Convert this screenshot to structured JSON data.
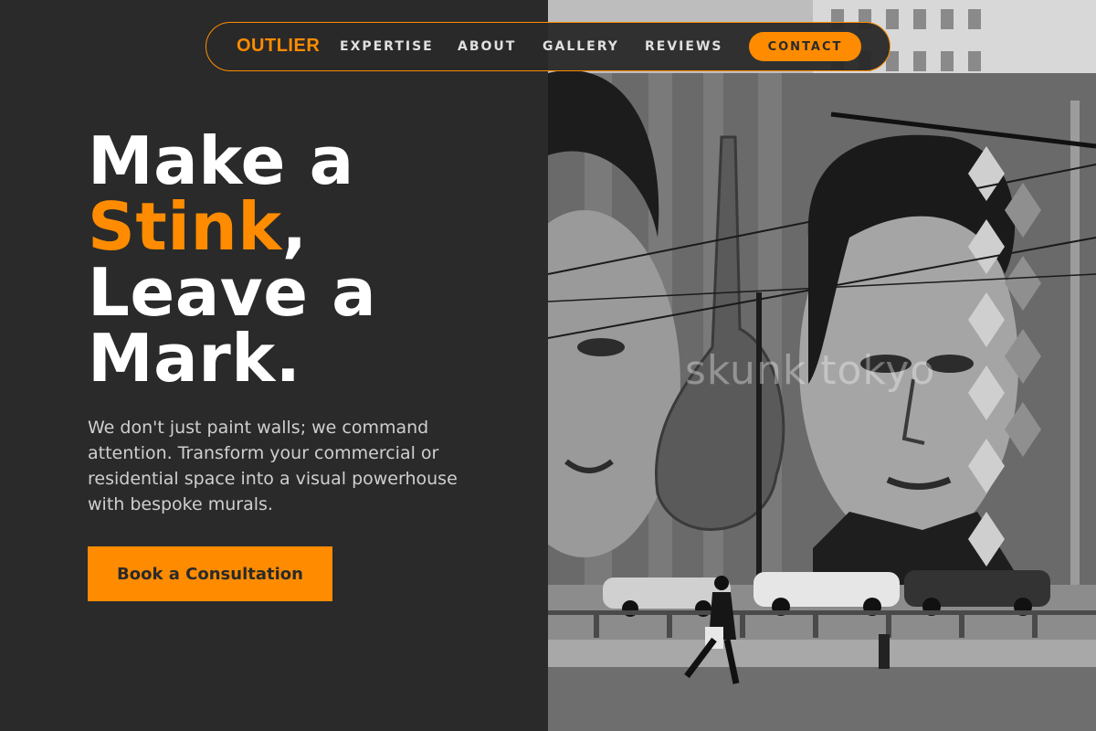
{
  "nav": {
    "logo": "OUTLIER",
    "links": [
      "EXPERTISE",
      "ABOUT",
      "GALLERY",
      "REVIEWS"
    ],
    "contact_label": "CONTACT"
  },
  "hero": {
    "headline_line1": "Make a",
    "headline_accent": "Stink",
    "headline_comma": ",",
    "headline_line3": "Leave a",
    "headline_line4": "Mark.",
    "lede": "We don't just paint walls; we command attention. Transform your commercial or residential space into a visual powerhouse with bespoke murals.",
    "cta_label": "Book a Consultation",
    "photo_watermark": "skunk tokyo"
  },
  "colors": {
    "accent": "#ff8c00",
    "background": "#2a2a2a",
    "text": "#ffffff",
    "muted_text": "#cfcfcf"
  }
}
